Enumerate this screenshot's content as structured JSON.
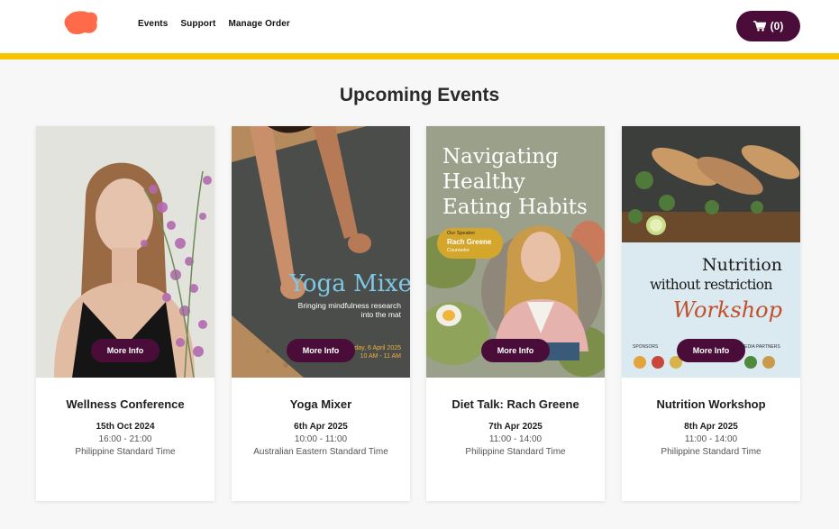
{
  "header": {
    "nav": [
      "Events",
      "Support",
      "Manage Order"
    ],
    "cart_label": "(0)"
  },
  "colors": {
    "accent": "#f8c400",
    "button": "#4a0d3a",
    "logo": "#ff6a4a"
  },
  "page_title": "Upcoming Events",
  "events": [
    {
      "title": "Wellness Conference",
      "date": "15th Oct 2024",
      "time": "16:00 - 21:00",
      "timezone": "Philippine Standard Time",
      "button": "More Info"
    },
    {
      "title": "Yoga Mixer",
      "date": "6th Apr 2025",
      "time": "10:00 - 11:00",
      "timezone": "Australian Eastern Standard Time",
      "button": "More Info",
      "poster": {
        "heading": "Yoga Mixer",
        "subheading": "Bringing mindfulness research into the mat",
        "date": "Saturday, 6 April 2025",
        "time": "10 AM - 11 AM"
      }
    },
    {
      "title": "Diet Talk: Rach Greene",
      "date": "7th Apr 2025",
      "time": "11:00 - 14:00",
      "timezone": "Philippine Standard Time",
      "button": "More Info",
      "poster": {
        "heading": "Navigating Healthy Eating Habits",
        "speaker_tag": "Our Speaker",
        "speaker_name": "Rach Greene",
        "speaker_role": "Counselor"
      }
    },
    {
      "title": "Nutrition Workshop",
      "date": "8th Apr 2025",
      "time": "11:00 - 14:00",
      "timezone": "Philippine Standard Time",
      "button": "More Info",
      "poster": {
        "line1": "Nutrition",
        "line2": "without restriction",
        "line3": "Workshop",
        "sponsors": "SPONSORS",
        "partners": "MEDIA PARTNERS"
      }
    }
  ]
}
